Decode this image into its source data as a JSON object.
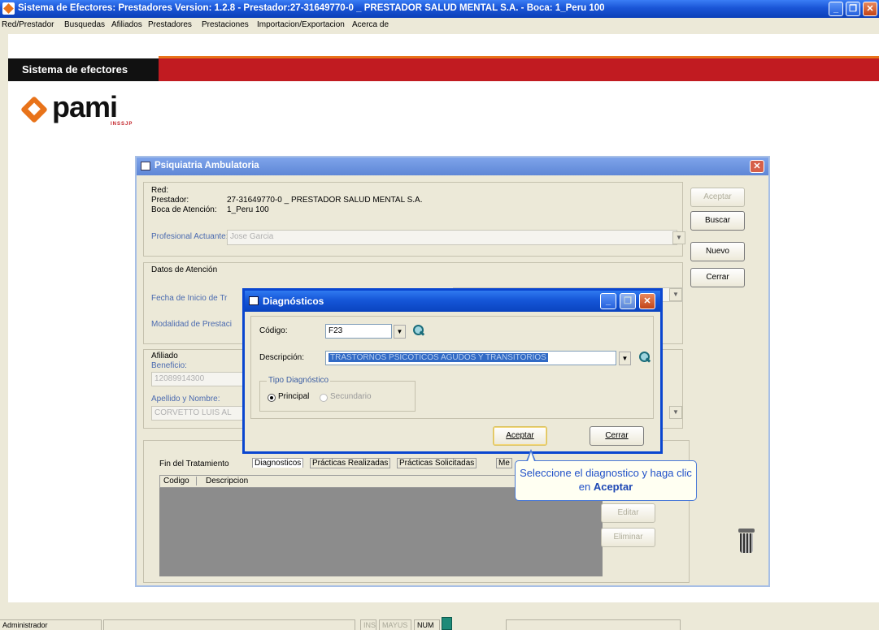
{
  "window": {
    "title": "Sistema de Efectores: Prestadores Version: 1.2.8 - Prestador:27-31649770-0 _ PRESTADOR SALUD MENTAL S.A. - Boca: 1_Peru 100"
  },
  "menu": [
    "Red/Prestador",
    "Busquedas",
    "Afiliados",
    "Prestadores",
    "Prestaciones",
    "Importacion/Exportacion",
    "Acerca de"
  ],
  "banner": {
    "label": "Sistema de efectores"
  },
  "logo": {
    "text": "pami",
    "sub": "INSSJP"
  },
  "psiq": {
    "title": "Psiquiatria Ambulatoria",
    "red_label": "Red:",
    "prestador_label": "Prestador:",
    "prestador_value": "27-31649770-0 _ PRESTADOR SALUD MENTAL S.A.",
    "boca_label": "Boca de Atención:",
    "boca_value": "1_Peru 100",
    "profesional_label": "Profesional Actuante:",
    "profesional_value": "Jose Garcia",
    "datos_label": "Datos de Atención",
    "fecha_label": "Fecha de Inicio de Tr",
    "modalidad_label": "Modalidad de Prestaci",
    "afiliado_label": "Afiliado",
    "beneficio_label": "Beneficio:",
    "beneficio_value": "12089914300",
    "apellido_label": "Apellido y Nombre:",
    "apellido_value": "CORVETTO LUIS AL",
    "buttons": {
      "aceptar": "Aceptar",
      "buscar": "Buscar",
      "nuevo": "Nuevo",
      "cerrar": "Cerrar",
      "editar": "Editar",
      "eliminar": "Eliminar"
    },
    "tabs": [
      "Fin del Tratamiento",
      "Diagnosticos",
      "Prácticas Realizadas",
      "Prácticas Solicitadas",
      "Me"
    ],
    "grid": {
      "columns": [
        "Codigo",
        "Descripcion"
      ]
    }
  },
  "dialog": {
    "title": "Diagnósticos",
    "codigo_label": "Código:",
    "codigo_value": "F23",
    "descripcion_label": "Descripción:",
    "descripcion_value": "TRASTORNOS PSICOTICOS AGUDOS Y TRANSITORIOS",
    "tipo_label": "Tipo Diagnóstico",
    "principal_label": "Principal",
    "secundario_label": "Secundario",
    "aceptar_label": "Aceptar",
    "cerrar_label": "Cerrar"
  },
  "tooltip": {
    "text": "Seleccione el diagnostico y haga clic en",
    "bold": "Aceptar"
  },
  "status": {
    "user": "Administrador",
    "ins": "INS",
    "mayus": "MAYUS",
    "num": "NUM"
  }
}
